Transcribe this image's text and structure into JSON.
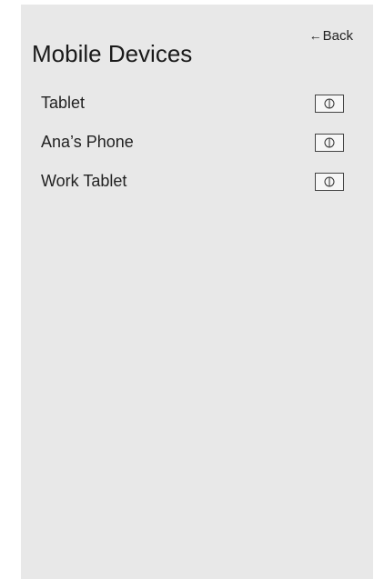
{
  "header": {
    "title": "Mobile Devices",
    "back_arrow": "←",
    "back_label": "Back"
  },
  "devices": [
    {
      "name": "Tablet",
      "action_icon": "power-icon"
    },
    {
      "name": "Ana’s Phone",
      "action_icon": "power-icon"
    },
    {
      "name": "Work Tablet",
      "action_icon": "power-icon"
    }
  ]
}
